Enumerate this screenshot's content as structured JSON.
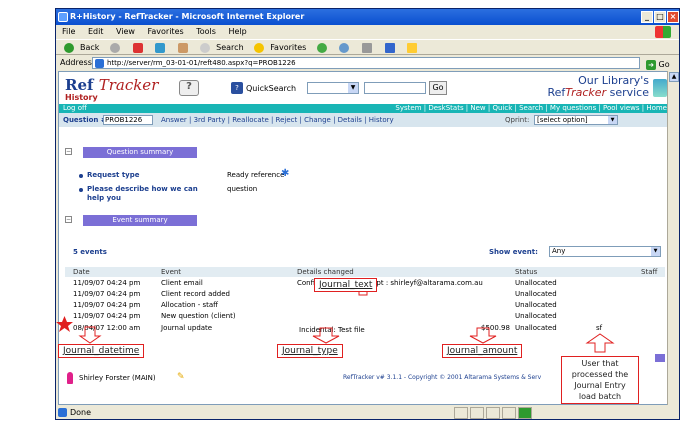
{
  "window": {
    "title": "R+History - RefTracker - Microsoft Internet Explorer",
    "buttons": [
      "_",
      "□",
      "×"
    ]
  },
  "menu": [
    "File",
    "Edit",
    "View",
    "Favorites",
    "Tools",
    "Help"
  ],
  "toolbar": {
    "back": "Back",
    "search": "Search",
    "favorites": "Favorites"
  },
  "address": {
    "label": "Address",
    "url": "http://server/rm_03-01-01/reft480.aspx?q=PROB1226",
    "go": "Go"
  },
  "app": {
    "logo": "Ref",
    "logo_italic": "Tracker",
    "logo_sub": "History",
    "quicksearch_label": "QuickSearch",
    "quicksearch_go": "Go",
    "library_line1": "Our Library's",
    "library_line2_a": "Ref",
    "library_line2_b": "Tracker",
    "library_line2_c": " service",
    "logoff": "Log off",
    "topnav": "System | DeskStats | New | Quick | Search | My questions | Pool views | Home",
    "question_label": "Question #",
    "question_value": "PROB1226",
    "question_nav": "Answer | 3rd Party | Reallocate | Reject | Change | Details | History",
    "qprint_label": "Qprint:",
    "qprint_value": "[select option]"
  },
  "summary": {
    "title": "Question summary",
    "rows": [
      {
        "label": "Request type",
        "value": "Ready reference"
      },
      {
        "label": "Please describe how we can help you",
        "label_line1": "Please describe how we can",
        "label_line2": "help you",
        "value": "question"
      }
    ]
  },
  "events": {
    "title": "Event summary",
    "count": "5 events",
    "show_label": "Show event:",
    "show_value": "Any",
    "headers": [
      "Date",
      "Event",
      "Details changed",
      "Status",
      "Staff"
    ],
    "rows": [
      {
        "date": "11/09/07 04:24 pm",
        "event": "Client email",
        "details": "Confirm question receipt : shirleyf@altarama.com.au",
        "amount": "",
        "status": "Unallocated",
        "staff": ""
      },
      {
        "date": "11/09/07 04:24 pm",
        "event": "Client record added",
        "details": "",
        "amount": "",
        "status": "Unallocated",
        "staff": ""
      },
      {
        "date": "11/09/07 04:24 pm",
        "event": "Allocation - staff",
        "details": "",
        "amount": "",
        "status": "Unallocated",
        "staff": ""
      },
      {
        "date": "11/09/07 04:24 pm",
        "event": "New question (client)",
        "details": "",
        "amount": "",
        "status": "Unallocated",
        "staff": ""
      },
      {
        "date": "08/04/07 12:00 am",
        "event": "Journal update",
        "details": "Incidental: Test file",
        "amount": "$500.98",
        "status": "Unallocated",
        "staff": "sf"
      }
    ]
  },
  "annotations": {
    "journal_text": "Journal_text",
    "journal_datetime": "Journal_datetime",
    "journal_type": "Journal_type",
    "journal_amount": "Journal_amount",
    "user_note_1": "User that",
    "user_note_2": "processed the",
    "user_note_3": "Journal Entry",
    "user_note_4": "load batch"
  },
  "footer": {
    "user": "Shirley Forster (MAIN)",
    "copyright": "RefTracker v# 3.1.1 - Copyright © 2001 Altarama Systems & Serv"
  },
  "status": {
    "text": "Done"
  },
  "colors": {
    "accent_red": "#e02020",
    "teal": "#18b5b5",
    "section": "#7b6fd6",
    "nav_blue": "#1c3f8f"
  }
}
